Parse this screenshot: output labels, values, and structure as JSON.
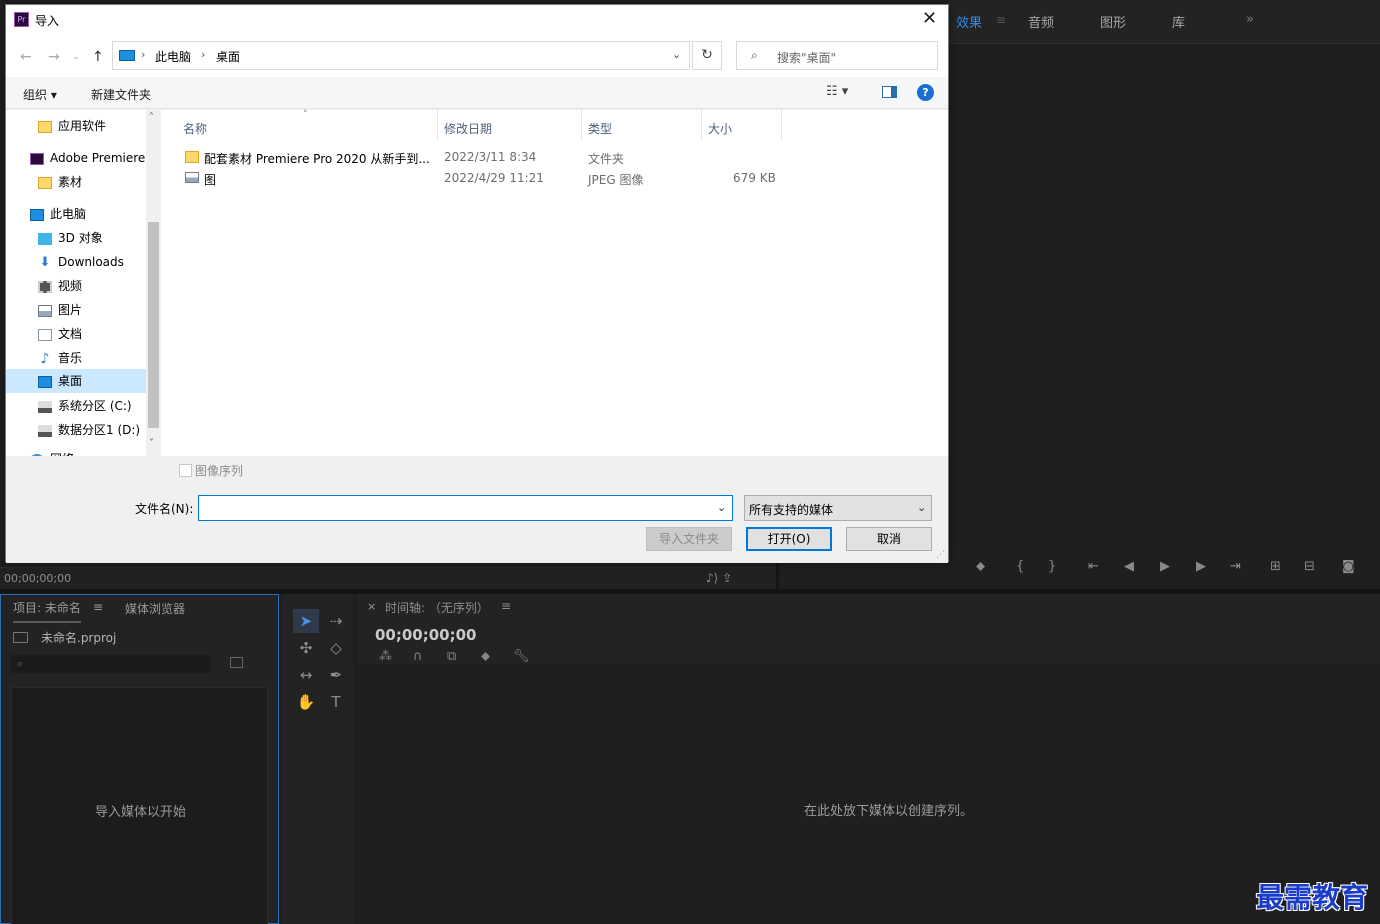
{
  "premiere": {
    "workspace_tabs": [
      "效果",
      "音频",
      "图形",
      "库"
    ],
    "workspace_menu_icon": "hamburger-icon",
    "more_icon": "double-chevron-right-icon",
    "source_timecode": "00;00;00;00",
    "project_panel": {
      "tab_project": "项目: 未命名",
      "tab_media_browser": "媒体浏览器",
      "file_name": "未命名.prproj",
      "drop_hint": "导入媒体以开始"
    },
    "timeline": {
      "close": "×",
      "tab": "时间轴: （无序列）",
      "timecode": "00;00;00;00",
      "empty_hint": "在此处放下媒体以创建序列。"
    },
    "watermark": "最需教育",
    "accent_color": "#2d8ceb"
  },
  "dialog": {
    "title": "导入",
    "close_glyph": "✕",
    "breadcrumb": [
      "此电脑",
      "桌面"
    ],
    "search_placeholder": "搜索\"桌面\"",
    "toolbar": {
      "organize": "组织 ▾",
      "new_folder": "新建文件夹",
      "view_glyph": "☷ ▾",
      "help": "?"
    },
    "nav_items": [
      {
        "label": "应用软件",
        "icon": "folder-icon"
      },
      {
        "label": "Adobe Premiere",
        "icon": "premiere-icon"
      },
      {
        "label": "素材",
        "icon": "folder-icon"
      },
      {
        "label": "此电脑",
        "icon": "computer-icon"
      },
      {
        "label": "3D 对象",
        "icon": "3d-objects-icon"
      },
      {
        "label": "Downloads",
        "icon": "download-icon"
      },
      {
        "label": "视频",
        "icon": "video-icon"
      },
      {
        "label": "图片",
        "icon": "pictures-icon"
      },
      {
        "label": "文档",
        "icon": "documents-icon"
      },
      {
        "label": "音乐",
        "icon": "music-icon"
      },
      {
        "label": "桌面",
        "icon": "desktop-icon"
      },
      {
        "label": "系统分区 (C:)",
        "icon": "drive-icon"
      },
      {
        "label": "数据分区1 (D:)",
        "icon": "drive-icon"
      },
      {
        "label": "网络",
        "icon": "network-icon"
      }
    ],
    "columns": [
      "名称",
      "修改日期",
      "类型",
      "大小"
    ],
    "files": [
      {
        "name": "配套素材 Premiere Pro 2020 从新手到...",
        "date": "2022/3/11 8:34",
        "type": "文件夹",
        "size": ""
      },
      {
        "name": "图",
        "date": "2022/4/29 11:21",
        "type": "JPEG 图像",
        "size": "679 KB"
      }
    ],
    "image_sequence_label": "图像序列",
    "filename_label": "文件名(N):",
    "filename_value": "",
    "filetype_value": "所有支持的媒体",
    "buttons": {
      "import_folder": "导入文件夹",
      "open": "打开(O)",
      "cancel": "取消"
    }
  }
}
